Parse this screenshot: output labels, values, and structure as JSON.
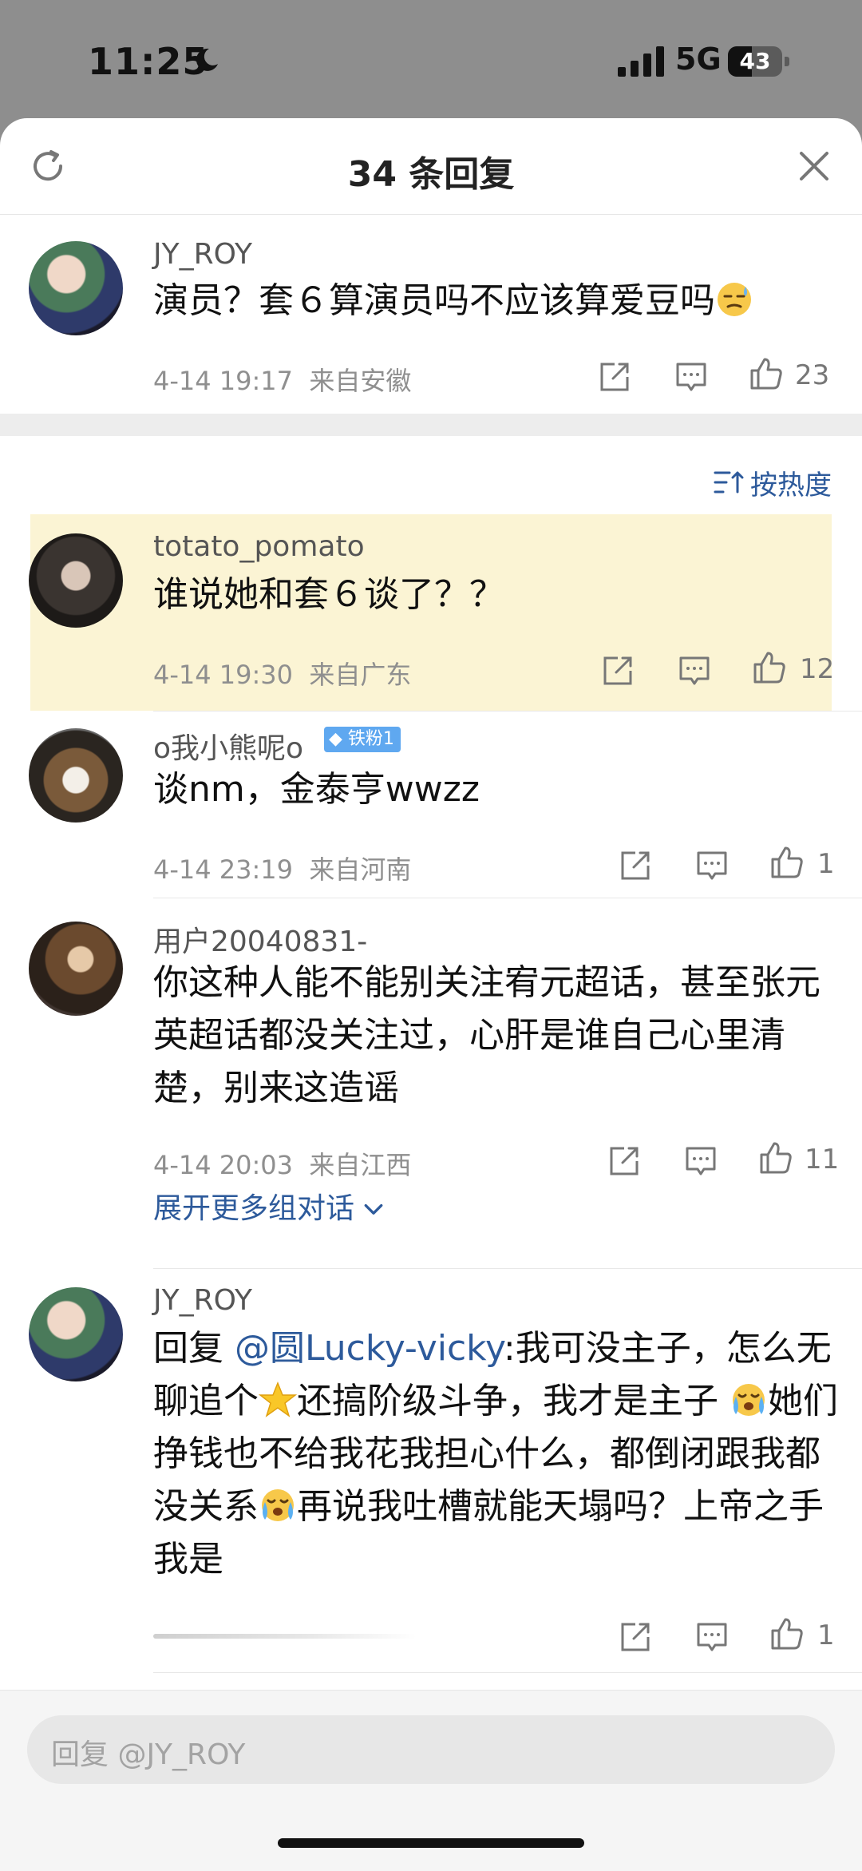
{
  "status_bar": {
    "time": "11:25",
    "network": "5G",
    "battery": "43"
  },
  "sheet": {
    "title": "34 条回复"
  },
  "main_comment": {
    "username": "JY_ROY",
    "text": "演员？套６算演员吗不应该算爱豆吗",
    "time": "4-14 19:17",
    "location": "来自安徽",
    "likes": "23"
  },
  "sort": {
    "label": "按热度"
  },
  "replies": [
    {
      "username": "totato_pomato",
      "text": "谁说她和套６谈了？？",
      "time": "4-14 19:30",
      "location": "来自广东",
      "likes": "12"
    },
    {
      "username": "o我小熊呢o",
      "badge": "铁粉1",
      "text": "谈nm，金泰亨wwzz",
      "time": "4-14 23:19",
      "location": "来自河南",
      "likes": "1"
    },
    {
      "username": "用户20040831-",
      "text": "你这种人能不能别关注宥元超话，甚至张元英超话都没关注过，心肝是谁自己心里清楚，别来这造谣",
      "time": "4-14 20:03",
      "location": "来自江西",
      "likes": "11",
      "expand": "展开更多组对话"
    },
    {
      "username": "JY_ROY",
      "reply_prefix": "回复",
      "mention": "@圆Lucky-vicky",
      "text_a": ":我可没主子，怎么无聊追个",
      "text_b": "还搞阶级斗争，我才是主子",
      "text_c": "她们挣钱也不给我花我担心什么，都倒闭跟我都没关系",
      "text_d": "再说我吐槽就能天塌吗？上帝之手我是",
      "likes": "1"
    }
  ],
  "reply_input": {
    "placeholder": "回复 @JY_ROY"
  },
  "colors": {
    "link": "#2d5a9b",
    "highlight": "#fbf4d4",
    "badge": "#5fa8f0"
  }
}
